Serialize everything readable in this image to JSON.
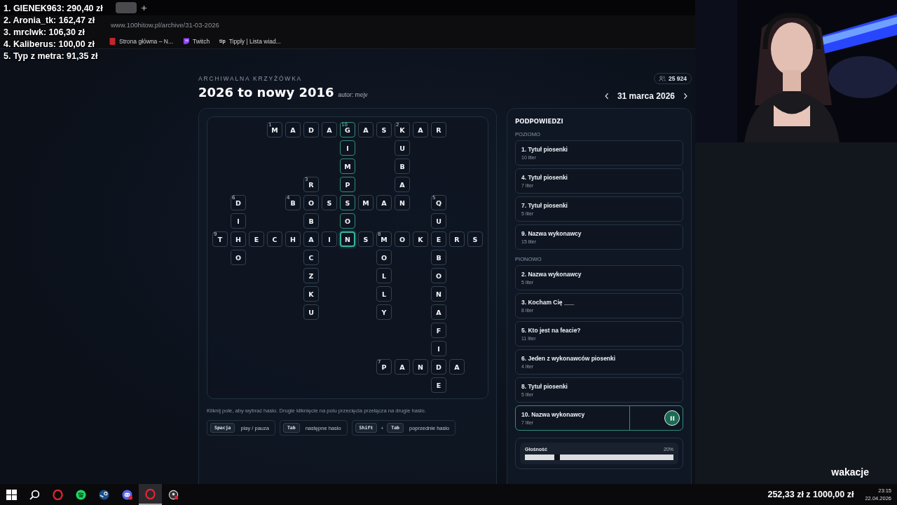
{
  "overlay": {
    "leaderboard": [
      "1. GIENEK963: 290,40 zł",
      "2. Aronia_tk: 162,47 zł",
      "3. mrclwk: 106,30 zł",
      "4. Kaliberus: 100,00 zł",
      "5. Typ z metra: 91,35 zł"
    ],
    "caption": "wakacje",
    "goal": "252,33 zł z 1000,00 zł"
  },
  "browser": {
    "url": "www.100hitow.pl/archive/31-03-2026",
    "bookmarks": [
      {
        "kind": "page",
        "label": "Strona główna – N..."
      },
      {
        "kind": "twitch",
        "label": "Twitch"
      },
      {
        "kind": "tipply",
        "icon_text": "tip",
        "label": "Tipply | Lista wiad..."
      }
    ]
  },
  "page": {
    "kicker": "ARCHIWALNA KRZYŻÓWKA",
    "title": "2026 to nowy 2016",
    "author": "autor: mejv",
    "players": "25 924",
    "date": "31 marca 2026",
    "grid": {
      "rows": [
        [
          null,
          null,
          null,
          {
            "letter": "M",
            "number": "1",
            "highlighted": false,
            "selected": false
          },
          {
            "letter": "A",
            "highlighted": false,
            "selected": false
          },
          {
            "letter": "D",
            "highlighted": false,
            "selected": false
          },
          {
            "letter": "A",
            "highlighted": false,
            "selected": false
          },
          {
            "letter": "G",
            "number": "10",
            "highlighted": true,
            "selected": false
          },
          {
            "letter": "A",
            "highlighted": false,
            "selected": false
          },
          {
            "letter": "S",
            "highlighted": false,
            "selected": false
          },
          {
            "letter": "K",
            "number": "2",
            "highlighted": false,
            "selected": false
          },
          {
            "letter": "A",
            "highlighted": false,
            "selected": false
          },
          {
            "letter": "R",
            "highlighted": false,
            "selected": false
          },
          null,
          null
        ],
        [
          null,
          null,
          null,
          null,
          null,
          null,
          null,
          {
            "letter": "I",
            "highlighted": true,
            "selected": false
          },
          null,
          null,
          {
            "letter": "U",
            "highlighted": false,
            "selected": false
          },
          null,
          null,
          null,
          null
        ],
        [
          null,
          null,
          null,
          null,
          null,
          null,
          null,
          {
            "letter": "M",
            "highlighted": true,
            "selected": false
          },
          null,
          null,
          {
            "letter": "B",
            "highlighted": false,
            "selected": false
          },
          null,
          null,
          null,
          null
        ],
        [
          null,
          null,
          null,
          null,
          null,
          {
            "letter": "R",
            "number": "3",
            "highlighted": false,
            "selected": false
          },
          null,
          {
            "letter": "P",
            "highlighted": true,
            "selected": false
          },
          null,
          null,
          {
            "letter": "A",
            "highlighted": false,
            "selected": false
          },
          null,
          null,
          null,
          null
        ],
        [
          null,
          {
            "letter": "D",
            "number": "6",
            "highlighted": false,
            "selected": false
          },
          null,
          null,
          {
            "letter": "B",
            "number": "4",
            "highlighted": false,
            "selected": false
          },
          {
            "letter": "O",
            "highlighted": false,
            "selected": false
          },
          {
            "letter": "S",
            "highlighted": false,
            "selected": false
          },
          {
            "letter": "S",
            "highlighted": true,
            "selected": false
          },
          {
            "letter": "M",
            "highlighted": false,
            "selected": false
          },
          {
            "letter": "A",
            "highlighted": false,
            "selected": false
          },
          {
            "letter": "N",
            "highlighted": false,
            "selected": false
          },
          null,
          {
            "letter": "Q",
            "number": "5",
            "highlighted": false,
            "selected": false
          },
          null,
          null
        ],
        [
          null,
          {
            "letter": "I",
            "highlighted": false,
            "selected": false
          },
          null,
          null,
          null,
          {
            "letter": "B",
            "highlighted": false,
            "selected": false
          },
          null,
          {
            "letter": "O",
            "highlighted": true,
            "selected": false
          },
          null,
          null,
          null,
          null,
          {
            "letter": "U",
            "highlighted": false,
            "selected": false
          },
          null,
          null
        ],
        [
          {
            "letter": "T",
            "number": "9",
            "highlighted": false,
            "selected": false
          },
          {
            "letter": "H",
            "highlighted": false,
            "selected": false
          },
          {
            "letter": "E",
            "highlighted": false,
            "selected": false
          },
          {
            "letter": "C",
            "highlighted": false,
            "selected": false
          },
          {
            "letter": "H",
            "highlighted": false,
            "selected": false
          },
          {
            "letter": "A",
            "highlighted": false,
            "selected": false
          },
          {
            "letter": "I",
            "highlighted": false,
            "selected": false
          },
          {
            "letter": "N",
            "highlighted": true,
            "selected": true
          },
          {
            "letter": "S",
            "highlighted": false,
            "selected": false
          },
          {
            "letter": "M",
            "number": "8",
            "highlighted": false,
            "selected": false
          },
          {
            "letter": "O",
            "highlighted": false,
            "selected": false
          },
          {
            "letter": "K",
            "highlighted": false,
            "selected": false
          },
          {
            "letter": "E",
            "highlighted": false,
            "selected": false
          },
          {
            "letter": "R",
            "highlighted": false,
            "selected": false
          },
          {
            "letter": "S",
            "highlighted": false,
            "selected": false
          }
        ],
        [
          null,
          {
            "letter": "O",
            "highlighted": false,
            "selected": false
          },
          null,
          null,
          null,
          {
            "letter": "C",
            "highlighted": false,
            "selected": false
          },
          null,
          null,
          null,
          {
            "letter": "O",
            "highlighted": false,
            "selected": false
          },
          null,
          null,
          {
            "letter": "B",
            "highlighted": false,
            "selected": false
          },
          null,
          null
        ],
        [
          null,
          null,
          null,
          null,
          null,
          {
            "letter": "Z",
            "highlighted": false,
            "selected": false
          },
          null,
          null,
          null,
          {
            "letter": "L",
            "highlighted": false,
            "selected": false
          },
          null,
          null,
          {
            "letter": "O",
            "highlighted": false,
            "selected": false
          },
          null,
          null
        ],
        [
          null,
          null,
          null,
          null,
          null,
          {
            "letter": "K",
            "highlighted": false,
            "selected": false
          },
          null,
          null,
          null,
          {
            "letter": "L",
            "highlighted": false,
            "selected": false
          },
          null,
          null,
          {
            "letter": "N",
            "highlighted": false,
            "selected": false
          },
          null,
          null
        ],
        [
          null,
          null,
          null,
          null,
          null,
          {
            "letter": "U",
            "highlighted": false,
            "selected": false
          },
          null,
          null,
          null,
          {
            "letter": "Y",
            "highlighted": false,
            "selected": false
          },
          null,
          null,
          {
            "letter": "A",
            "highlighted": false,
            "selected": false
          },
          null,
          null
        ],
        [
          null,
          null,
          null,
          null,
          null,
          null,
          null,
          null,
          null,
          null,
          null,
          null,
          {
            "letter": "F",
            "highlighted": false,
            "selected": false
          },
          null,
          null
        ],
        [
          null,
          null,
          null,
          null,
          null,
          null,
          null,
          null,
          null,
          null,
          null,
          null,
          {
            "letter": "I",
            "highlighted": false,
            "selected": false
          },
          null,
          null
        ],
        [
          null,
          null,
          null,
          null,
          null,
          null,
          null,
          null,
          null,
          {
            "letter": "P",
            "number": "7",
            "highlighted": false,
            "selected": false
          },
          {
            "letter": "A",
            "highlighted": false,
            "selected": false
          },
          {
            "letter": "N",
            "highlighted": false,
            "selected": false
          },
          {
            "letter": "D",
            "highlighted": false,
            "selected": false
          },
          {
            "letter": "A",
            "highlighted": false,
            "selected": false
          },
          null
        ],
        [
          null,
          null,
          null,
          null,
          null,
          null,
          null,
          null,
          null,
          null,
          null,
          null,
          {
            "letter": "E",
            "highlighted": false,
            "selected": false
          },
          null,
          null
        ]
      ]
    },
    "hint": "Kliknij pole, aby wybrać hasło. Drugie kliknięcie na polu przecięcia przełącza na drugie hasło.",
    "shortcuts": [
      {
        "keys": [
          "Spacja"
        ],
        "action": "play / pauza"
      },
      {
        "keys": [
          "Tab"
        ],
        "action": "następne hasło"
      },
      {
        "keys": [
          "Shift",
          "Tab"
        ],
        "joiner": "+",
        "action": "poprzednie hasło"
      }
    ]
  },
  "clues": {
    "title": "PODPOWIEDZI",
    "sections": [
      {
        "heading": "POZIOMO",
        "items": [
          {
            "text": "1. Tytuł piosenki",
            "length": "10 liter",
            "selected": false
          },
          {
            "text": "4. Tytuł piosenki",
            "length": "7 liter",
            "selected": false
          },
          {
            "text": "7. Tytuł piosenki",
            "length": "5 liter",
            "selected": false
          },
          {
            "text": "9. Nazwa wykonawcy",
            "length": "15 liter",
            "selected": false
          }
        ]
      },
      {
        "heading": "PIONOWO",
        "items": [
          {
            "text": "2. Nazwa wykonawcy",
            "length": "5 liter",
            "selected": false
          },
          {
            "text": "3. Kocham Cię ___",
            "length": "8 liter",
            "selected": false
          },
          {
            "text": "5. Kto jest na feacie?",
            "length": "11 liter",
            "selected": false
          },
          {
            "text": "6. Jeden z wykonawców piosenki",
            "length": "4 liter",
            "selected": false
          },
          {
            "text": "8. Tytuł piosenki",
            "length": "5 liter",
            "selected": false
          },
          {
            "text": "10. Nazwa wykonawcy",
            "length": "7 liter",
            "selected": true,
            "playing": true
          }
        ]
      }
    ],
    "volume": {
      "label": "Głośność",
      "reading": "20%",
      "level": 0.2
    }
  },
  "taskbar": {
    "apps": [
      {
        "kind": "start",
        "active": false
      },
      {
        "kind": "search",
        "active": false
      },
      {
        "kind": "opera",
        "active": false
      },
      {
        "kind": "spotify",
        "active": false
      },
      {
        "kind": "steam",
        "active": false
      },
      {
        "kind": "discord",
        "active": false
      },
      {
        "kind": "opera",
        "active": true
      },
      {
        "kind": "recorder",
        "active": false
      }
    ],
    "time": "23:15",
    "date": "22.04.2026"
  }
}
